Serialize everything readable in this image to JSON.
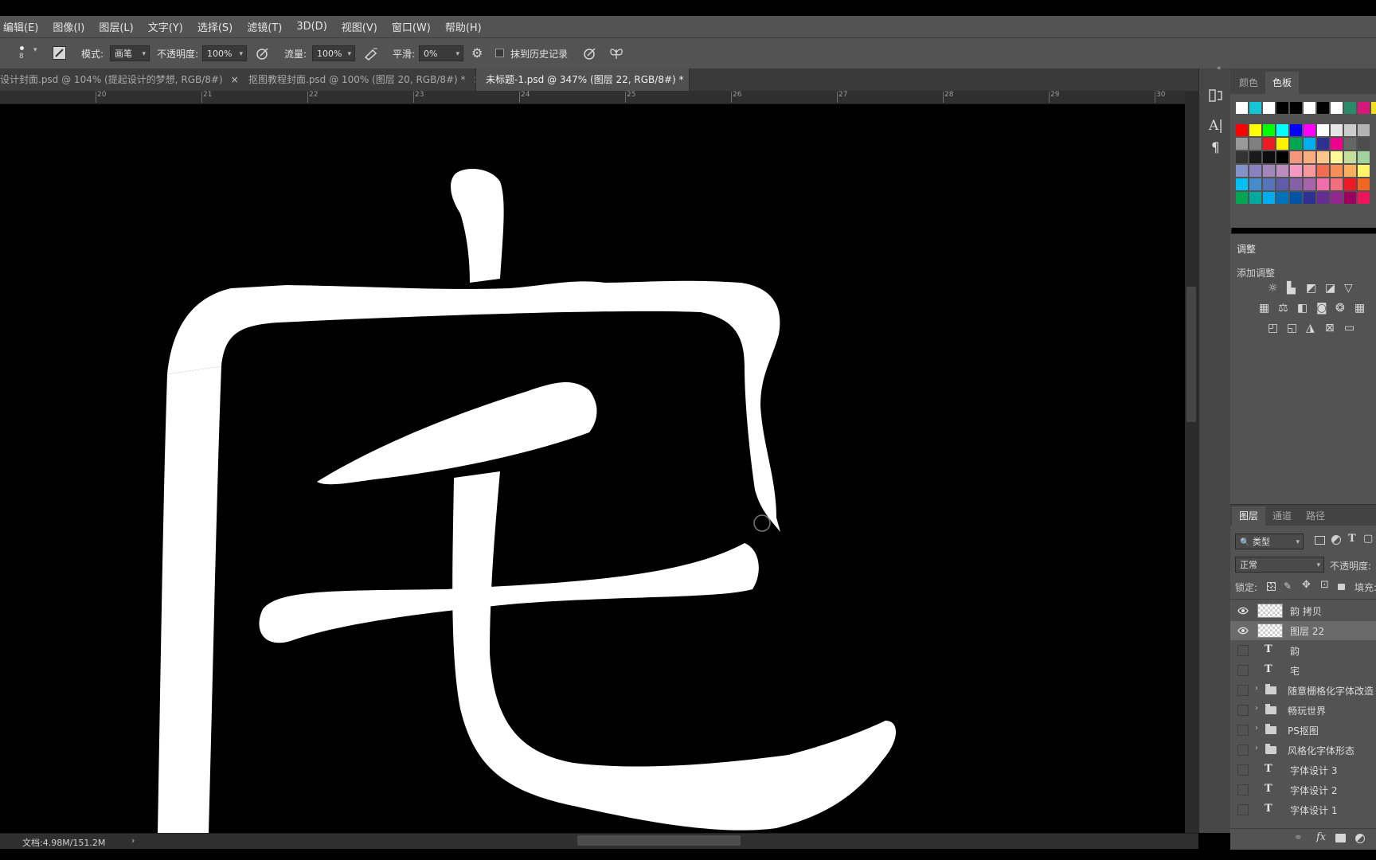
{
  "menubar": {
    "items": [
      "编辑(E)",
      "图像(I)",
      "图层(L)",
      "文字(Y)",
      "选择(S)",
      "滤镜(T)",
      "3D(D)",
      "视图(V)",
      "窗口(W)",
      "帮助(H)"
    ]
  },
  "options": {
    "brush_size": "8",
    "mode_label": "模式:",
    "mode_value": "画笔",
    "opacity_label": "不透明度:",
    "opacity_value": "100%",
    "flow_label": "流量:",
    "flow_value": "100%",
    "smooth_label": "平滑:",
    "smooth_value": "0%",
    "erase_history_label": "抹到历史记录"
  },
  "tabs": [
    {
      "label": "设计封面.psd @ 104% (提起设计的梦想, RGB/8#)",
      "active": false
    },
    {
      "label": "抠图教程封面.psd @ 100% (图层 20, RGB/8#) *",
      "active": false
    },
    {
      "label": "未标题-1.psd @ 347% (图层 22, RGB/8#) *",
      "active": true
    }
  ],
  "ruler": {
    "ticks": [
      "20",
      "21",
      "22",
      "23",
      "24",
      "25",
      "26",
      "27",
      "28",
      "29",
      "30"
    ]
  },
  "status": {
    "doc_info": "文档:4.98M/151.2M"
  },
  "swatches_panel": {
    "tabs": [
      "颜色",
      "色板"
    ],
    "active_tab": "色板",
    "recent_colors": [
      "#ffffff",
      "#16c6d6",
      "#ffffff",
      "#000000",
      "#000000",
      "#ffffff",
      "#000000",
      "#ffffff",
      "#2a8a6a",
      "#d6187a",
      "#f0e020"
    ],
    "rows": [
      [
        "#ff0000",
        "#ffff00",
        "#00ff00",
        "#00ffff",
        "#0000ff",
        "#ff00ff",
        "#ffffff",
        "#e6e6e6",
        "#cccccc",
        "#b3b3b3"
      ],
      [
        "#999999",
        "#808080",
        "#ed1c24",
        "#fff200",
        "#00a651",
        "#00aeef",
        "#2e3192",
        "#ec008c",
        "#666666",
        "#4d4d4d"
      ],
      [
        "#333333",
        "#1a1a1a",
        "#0d0d0d",
        "#000000",
        "#f7977a",
        "#f9ad81",
        "#fdc68a",
        "#fff799",
        "#c4df9b",
        "#a3d39c"
      ],
      [
        "#8393ca",
        "#8781bd",
        "#a186be",
        "#bd8cbf",
        "#f49ac2",
        "#f6989d",
        "#f26c4f",
        "#f68e56",
        "#fbaf5d",
        "#fff568"
      ],
      [
        "#00bff3",
        "#448ccb",
        "#5674b9",
        "#605ca8",
        "#8560a8",
        "#a864a8",
        "#f06eaa",
        "#f26d7d",
        "#ed1c24",
        "#f26522"
      ],
      [
        "#00a651",
        "#00a99d",
        "#00aeef",
        "#0072bc",
        "#0054a6",
        "#2e3192",
        "#662d91",
        "#92278f",
        "#9e005d",
        "#ed145b"
      ]
    ]
  },
  "adjustments": {
    "title": "调整",
    "add_label": "添加调整"
  },
  "layers_panel": {
    "tabs": [
      "图层",
      "通道",
      "路径"
    ],
    "filter_value": "类型",
    "blend_value": "正常",
    "opacity_label": "不透明度:",
    "lock_label": "锁定:",
    "fill_label": "填充:",
    "layers": [
      {
        "name": "韵 拷贝",
        "kind": "pixel",
        "visible": true,
        "selected": false
      },
      {
        "name": "图层 22",
        "kind": "pixel",
        "visible": true,
        "selected": true
      },
      {
        "name": "韵",
        "kind": "text",
        "visible": false,
        "selected": false
      },
      {
        "name": "宅",
        "kind": "text",
        "visible": false,
        "selected": false
      },
      {
        "name": "随意栅格化字体改造",
        "kind": "group",
        "visible": false,
        "selected": false
      },
      {
        "name": "畅玩世界",
        "kind": "group",
        "visible": false,
        "selected": false
      },
      {
        "name": "PS抠图",
        "kind": "group",
        "visible": false,
        "selected": false
      },
      {
        "name": "风格化字体形态",
        "kind": "group",
        "visible": false,
        "selected": false
      },
      {
        "name": "字体设计 3",
        "kind": "text",
        "visible": false,
        "selected": false
      },
      {
        "name": "字体设计 2",
        "kind": "text",
        "visible": false,
        "selected": false
      },
      {
        "name": "字体设计 1",
        "kind": "text",
        "visible": false,
        "selected": false
      }
    ]
  }
}
